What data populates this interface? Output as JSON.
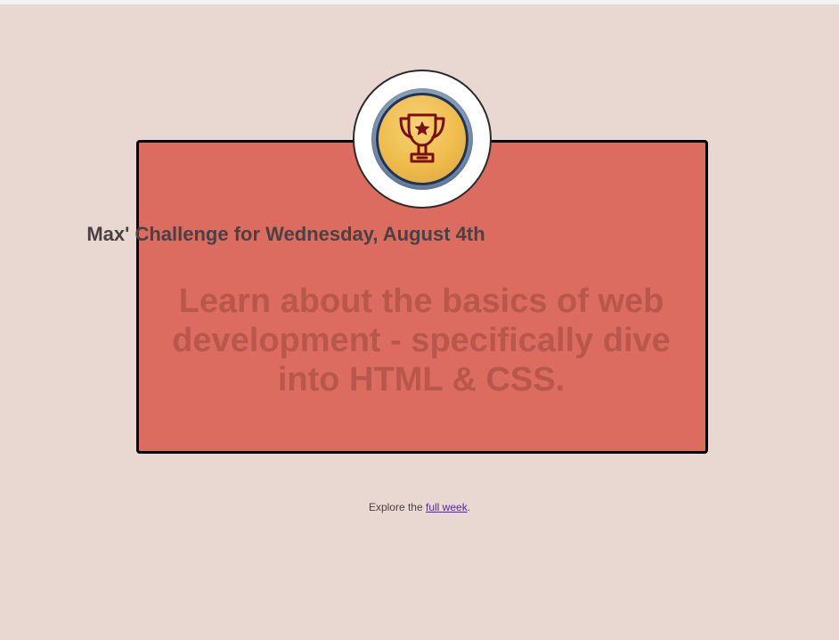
{
  "challenge": {
    "title": "Max' Challenge for Wednesday, August 4th",
    "description": "Learn about the basics of web development - specifically dive into HTML & CSS.",
    "icon": "trophy-icon"
  },
  "footer": {
    "prefix": "Explore the ",
    "link_label": "full week",
    "suffix": "."
  },
  "colors": {
    "page_background": "#e9d8d1",
    "card_background": "#dc6c5f",
    "title_text": "#4a4144",
    "challenge_text": "#b8574c",
    "link": "#5a1fb0",
    "trophy": "#7a0f12",
    "badge_gold": "#efbc4c"
  }
}
